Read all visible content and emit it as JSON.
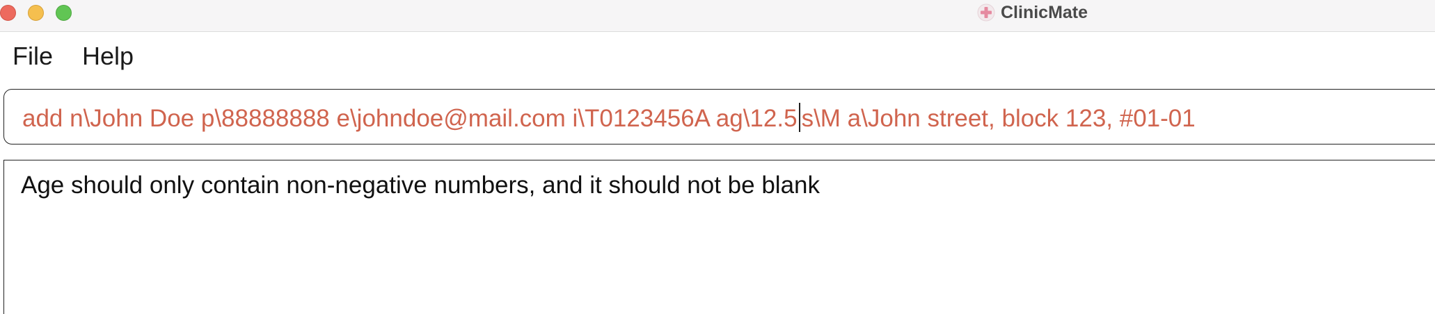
{
  "window": {
    "title": "ClinicMate",
    "app_icon": "medical-cross-icon",
    "colors": {
      "close": "#ed6a5e",
      "minimize": "#f5bf4f",
      "zoom": "#61c554",
      "command_text": "#d0644e"
    }
  },
  "menu": {
    "file_label": "File",
    "help_label": "Help"
  },
  "command": {
    "value_before_caret": "add n\\John Doe p\\88888888 e\\johndoe@mail.com i\\T0123456A ag\\12.5",
    "value_after_caret": "s\\M a\\John street, block 123, #01-01"
  },
  "result": {
    "message": "Age should only contain non-negative numbers, and it should not be blank"
  }
}
